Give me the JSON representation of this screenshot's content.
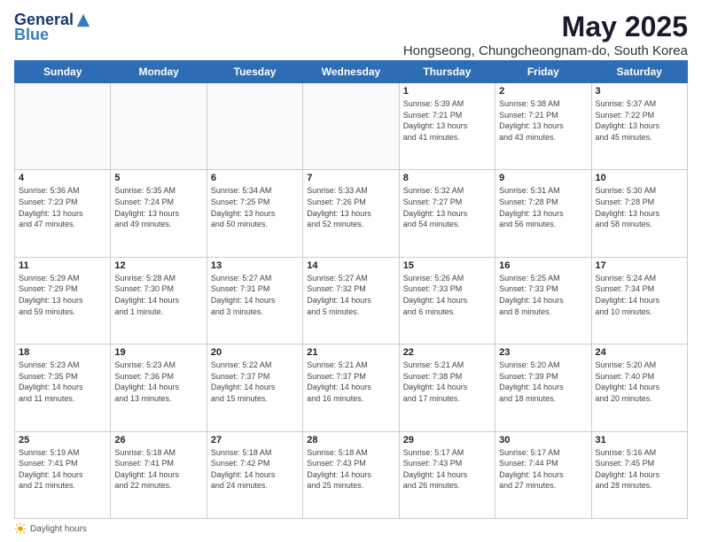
{
  "logo": {
    "general": "General",
    "blue": "Blue"
  },
  "title": "May 2025",
  "subtitle": "Hongseong, Chungcheongnam-do, South Korea",
  "days_of_week": [
    "Sunday",
    "Monday",
    "Tuesday",
    "Wednesday",
    "Thursday",
    "Friday",
    "Saturday"
  ],
  "footer": {
    "label": "Daylight hours"
  },
  "weeks": [
    [
      {
        "day": "",
        "info": ""
      },
      {
        "day": "",
        "info": ""
      },
      {
        "day": "",
        "info": ""
      },
      {
        "day": "",
        "info": ""
      },
      {
        "day": "1",
        "info": "Sunrise: 5:39 AM\nSunset: 7:21 PM\nDaylight: 13 hours\nand 41 minutes."
      },
      {
        "day": "2",
        "info": "Sunrise: 5:38 AM\nSunset: 7:21 PM\nDaylight: 13 hours\nand 43 minutes."
      },
      {
        "day": "3",
        "info": "Sunrise: 5:37 AM\nSunset: 7:22 PM\nDaylight: 13 hours\nand 45 minutes."
      }
    ],
    [
      {
        "day": "4",
        "info": "Sunrise: 5:36 AM\nSunset: 7:23 PM\nDaylight: 13 hours\nand 47 minutes."
      },
      {
        "day": "5",
        "info": "Sunrise: 5:35 AM\nSunset: 7:24 PM\nDaylight: 13 hours\nand 49 minutes."
      },
      {
        "day": "6",
        "info": "Sunrise: 5:34 AM\nSunset: 7:25 PM\nDaylight: 13 hours\nand 50 minutes."
      },
      {
        "day": "7",
        "info": "Sunrise: 5:33 AM\nSunset: 7:26 PM\nDaylight: 13 hours\nand 52 minutes."
      },
      {
        "day": "8",
        "info": "Sunrise: 5:32 AM\nSunset: 7:27 PM\nDaylight: 13 hours\nand 54 minutes."
      },
      {
        "day": "9",
        "info": "Sunrise: 5:31 AM\nSunset: 7:28 PM\nDaylight: 13 hours\nand 56 minutes."
      },
      {
        "day": "10",
        "info": "Sunrise: 5:30 AM\nSunset: 7:28 PM\nDaylight: 13 hours\nand 58 minutes."
      }
    ],
    [
      {
        "day": "11",
        "info": "Sunrise: 5:29 AM\nSunset: 7:29 PM\nDaylight: 13 hours\nand 59 minutes."
      },
      {
        "day": "12",
        "info": "Sunrise: 5:28 AM\nSunset: 7:30 PM\nDaylight: 14 hours\nand 1 minute."
      },
      {
        "day": "13",
        "info": "Sunrise: 5:27 AM\nSunset: 7:31 PM\nDaylight: 14 hours\nand 3 minutes."
      },
      {
        "day": "14",
        "info": "Sunrise: 5:27 AM\nSunset: 7:32 PM\nDaylight: 14 hours\nand 5 minutes."
      },
      {
        "day": "15",
        "info": "Sunrise: 5:26 AM\nSunset: 7:33 PM\nDaylight: 14 hours\nand 6 minutes."
      },
      {
        "day": "16",
        "info": "Sunrise: 5:25 AM\nSunset: 7:33 PM\nDaylight: 14 hours\nand 8 minutes."
      },
      {
        "day": "17",
        "info": "Sunrise: 5:24 AM\nSunset: 7:34 PM\nDaylight: 14 hours\nand 10 minutes."
      }
    ],
    [
      {
        "day": "18",
        "info": "Sunrise: 5:23 AM\nSunset: 7:35 PM\nDaylight: 14 hours\nand 11 minutes."
      },
      {
        "day": "19",
        "info": "Sunrise: 5:23 AM\nSunset: 7:36 PM\nDaylight: 14 hours\nand 13 minutes."
      },
      {
        "day": "20",
        "info": "Sunrise: 5:22 AM\nSunset: 7:37 PM\nDaylight: 14 hours\nand 15 minutes."
      },
      {
        "day": "21",
        "info": "Sunrise: 5:21 AM\nSunset: 7:37 PM\nDaylight: 14 hours\nand 16 minutes."
      },
      {
        "day": "22",
        "info": "Sunrise: 5:21 AM\nSunset: 7:38 PM\nDaylight: 14 hours\nand 17 minutes."
      },
      {
        "day": "23",
        "info": "Sunrise: 5:20 AM\nSunset: 7:39 PM\nDaylight: 14 hours\nand 18 minutes."
      },
      {
        "day": "24",
        "info": "Sunrise: 5:20 AM\nSunset: 7:40 PM\nDaylight: 14 hours\nand 20 minutes."
      }
    ],
    [
      {
        "day": "25",
        "info": "Sunrise: 5:19 AM\nSunset: 7:41 PM\nDaylight: 14 hours\nand 21 minutes."
      },
      {
        "day": "26",
        "info": "Sunrise: 5:18 AM\nSunset: 7:41 PM\nDaylight: 14 hours\nand 22 minutes."
      },
      {
        "day": "27",
        "info": "Sunrise: 5:18 AM\nSunset: 7:42 PM\nDaylight: 14 hours\nand 24 minutes."
      },
      {
        "day": "28",
        "info": "Sunrise: 5:18 AM\nSunset: 7:43 PM\nDaylight: 14 hours\nand 25 minutes."
      },
      {
        "day": "29",
        "info": "Sunrise: 5:17 AM\nSunset: 7:43 PM\nDaylight: 14 hours\nand 26 minutes."
      },
      {
        "day": "30",
        "info": "Sunrise: 5:17 AM\nSunset: 7:44 PM\nDaylight: 14 hours\nand 27 minutes."
      },
      {
        "day": "31",
        "info": "Sunrise: 5:16 AM\nSunset: 7:45 PM\nDaylight: 14 hours\nand 28 minutes."
      }
    ]
  ]
}
